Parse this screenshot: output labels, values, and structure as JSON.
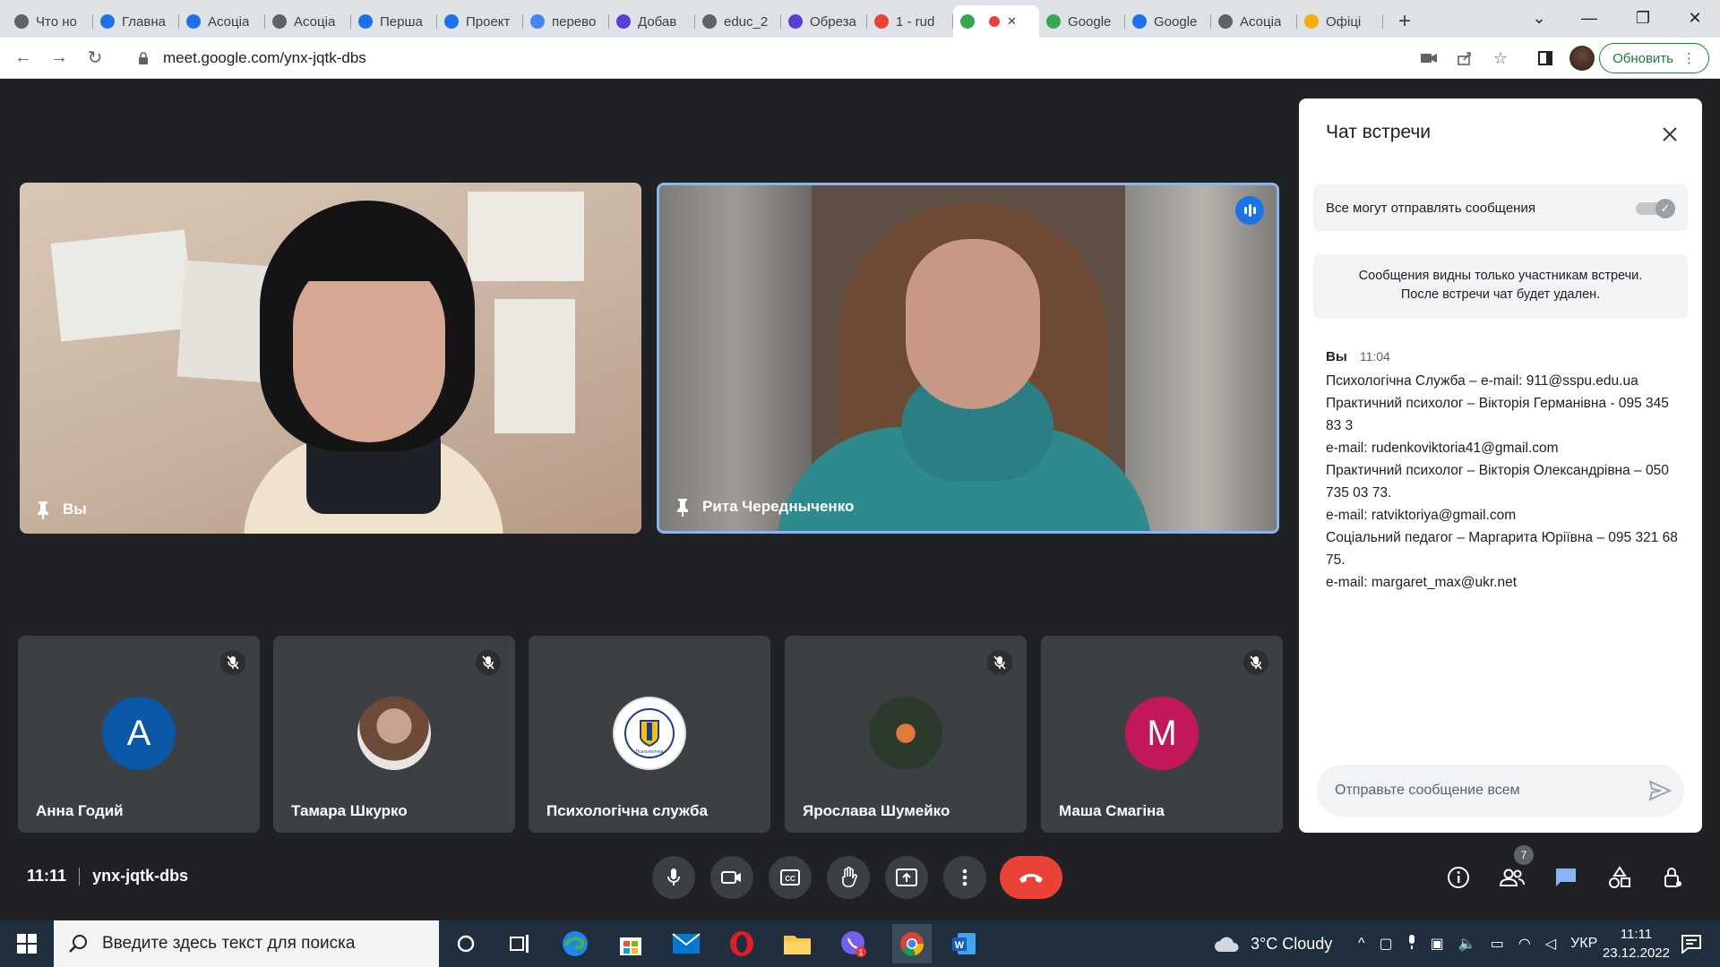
{
  "browser": {
    "tabs": [
      {
        "title": "Что но",
        "color": "#5f6368"
      },
      {
        "title": "Главна",
        "color": "#1a73e8"
      },
      {
        "title": "Асоціа",
        "color": "#1a73e8"
      },
      {
        "title": "Асоціа",
        "color": "#5f6368"
      },
      {
        "title": "Перша",
        "color": "#1a73e8"
      },
      {
        "title": "Проект",
        "color": "#1a73e8"
      },
      {
        "title": "перево",
        "color": "#4285f4"
      },
      {
        "title": "Добав",
        "color": "#5a3fd6"
      },
      {
        "title": "educ_2",
        "color": "#5f6368"
      },
      {
        "title": "Обреза",
        "color": "#5a3fd6"
      },
      {
        "title": "1 - rud",
        "color": "#ea4335"
      },
      {
        "title": "",
        "color": "#34a853"
      },
      {
        "title": "Google",
        "color": "#34a853"
      },
      {
        "title": "Google",
        "color": "#1a73e8"
      },
      {
        "title": "Асоціа",
        "color": "#5f6368"
      },
      {
        "title": "Офіці",
        "color": "#f9ab00"
      }
    ],
    "url": "meet.google.com/ynx-jqtk-dbs",
    "update_label": "Обновить"
  },
  "meeting": {
    "code": "ynx-jqtk-dbs",
    "time": "11:11",
    "video_tiles": [
      {
        "name": "Вы"
      },
      {
        "name": "Рита Чередныченко"
      }
    ],
    "participants": [
      {
        "name": "Анна Годий",
        "avatar": "A",
        "avatar_color": "#0b57a8",
        "muted": true
      },
      {
        "name": "Тамара Шкурко",
        "avatar": "",
        "avatar_color": "#7a6a60",
        "muted": true
      },
      {
        "name": "Психологічна служба",
        "avatar": "",
        "avatar_color": "#ffffff",
        "muted": false
      },
      {
        "name": "Ярослава Шумейко",
        "avatar": "",
        "avatar_color": "#2c3a2e",
        "muted": true
      },
      {
        "name": "Маша Смагіна",
        "avatar": "M",
        "avatar_color": "#c2185b",
        "muted": true
      }
    ],
    "participant_count": "7"
  },
  "chat": {
    "title": "Чат встречи",
    "permission_label": "Все могут отправлять сообщения",
    "notice_line1": "Сообщения видны только участникам встречи.",
    "notice_line2": "После встречи чат будет удален.",
    "message": {
      "sender": "Вы",
      "time": "11:04",
      "lines": [
        "Психологічна Служба – e-mail: 911@sspu.edu.ua",
        "Практичний психолог – Вікторія Германівна - 095 345 83 3",
        "e-mail: rudenkoviktoria41@gmail.com",
        "Практичний психолог – Вікторія Олександрівна – 050 735 03 73.",
        "e-mail: ratviktoriya@gmail.com",
        "Соціальний педагог – Маргарита Юріївна – 095 321 68 75.",
        "e-mail: margaret_max@ukr.net"
      ]
    },
    "compose_placeholder": "Отправьте сообщение всем"
  },
  "taskbar": {
    "search_placeholder": "Введите здесь текст для поиска",
    "weather": "3°C  Cloudy",
    "language": "УКР",
    "time": "11:11",
    "date": "23.12.2022",
    "viber_badge": "1"
  }
}
